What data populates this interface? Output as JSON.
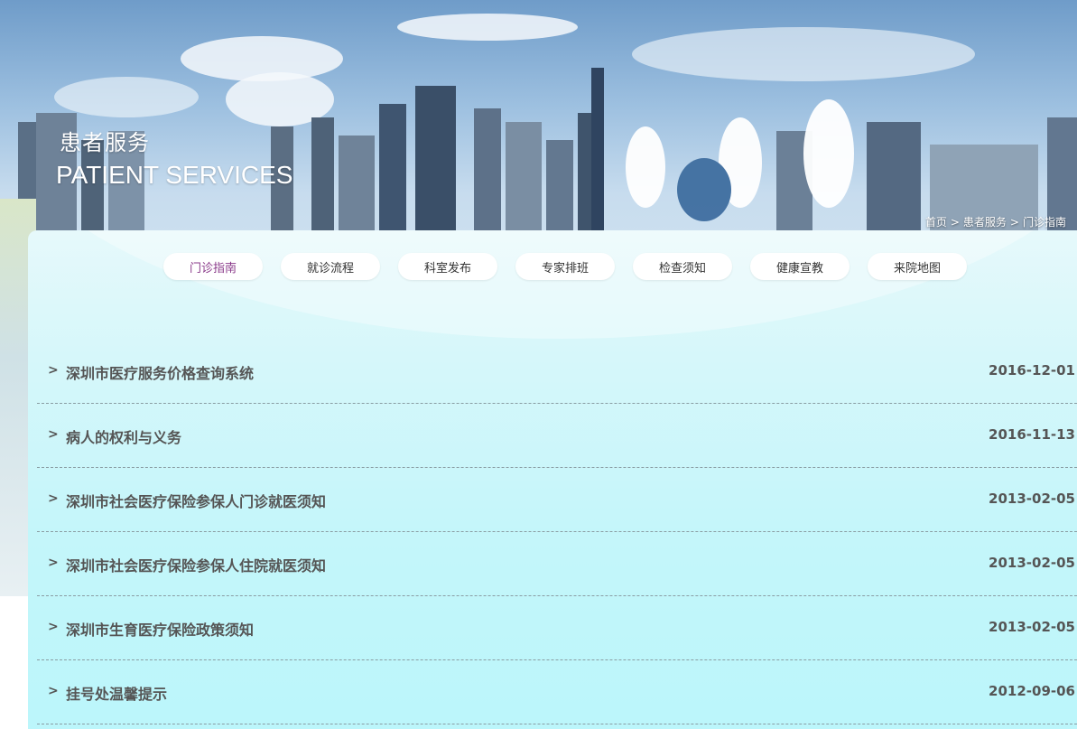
{
  "banner": {
    "title": "患者服务",
    "subtitle": "PATIENT SERVICES"
  },
  "breadcrumb": [
    {
      "label": "首页"
    },
    {
      "label": "患者服务"
    },
    {
      "label": "门诊指南"
    }
  ],
  "breadcrumb_separator": ">",
  "tabs": [
    {
      "label": "门诊指南",
      "active": true
    },
    {
      "label": "就诊流程"
    },
    {
      "label": "科室发布"
    },
    {
      "label": "专家排班"
    },
    {
      "label": "检查须知"
    },
    {
      "label": "健康宣教"
    },
    {
      "label": "来院地图"
    }
  ],
  "list_marker": ">",
  "news": [
    {
      "title": "深圳市医疗服务价格查询系统",
      "date": "2016-12-01"
    },
    {
      "title": "病人的权利与义务",
      "date": "2016-11-13"
    },
    {
      "title": "深圳市社会医疗保险参保人门诊就医须知",
      "date": "2013-02-05"
    },
    {
      "title": "深圳市社会医疗保险参保人住院就医须知",
      "date": "2013-02-05"
    },
    {
      "title": "深圳市生育医疗保险政策须知",
      "date": "2013-02-05"
    },
    {
      "title": "挂号处温馨提示",
      "date": "2012-09-06"
    }
  ]
}
